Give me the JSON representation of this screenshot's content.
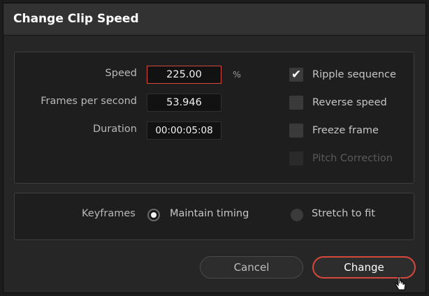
{
  "dialog": {
    "title": "Change Clip Speed"
  },
  "fields": {
    "speed": {
      "label": "Speed",
      "value": "225.00",
      "unit": "%"
    },
    "fps": {
      "label": "Frames per second",
      "value": "53.946"
    },
    "duration": {
      "label": "Duration",
      "value": "00:00:05:08"
    }
  },
  "options": {
    "ripple_sequence": {
      "label": "Ripple sequence",
      "checked": true,
      "check_glyph": "✔"
    },
    "reverse_speed": {
      "label": "Reverse speed",
      "checked": false
    },
    "freeze_frame": {
      "label": "Freeze frame",
      "checked": false
    },
    "pitch_correction": {
      "label": "Pitch Correction",
      "checked": false,
      "disabled": true
    }
  },
  "keyframes": {
    "label": "Keyframes",
    "options": [
      {
        "label": "Maintain timing",
        "selected": true
      },
      {
        "label": "Stretch to fit",
        "selected": false
      }
    ]
  },
  "buttons": {
    "cancel": "Cancel",
    "change": "Change"
  },
  "colors": {
    "accent": "#d6473c",
    "background": "#262626"
  },
  "icons": {
    "cursor": "pointer-cursor-icon"
  }
}
